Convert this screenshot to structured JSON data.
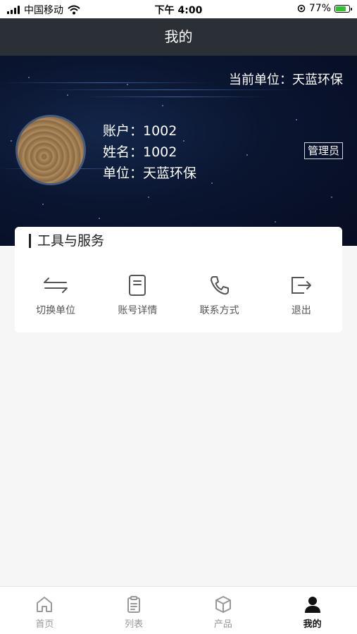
{
  "status_bar": {
    "carrier": "中国移动",
    "time": "下午 4:00",
    "battery": "77%"
  },
  "nav": {
    "title": "我的"
  },
  "header": {
    "current_unit": "当前单位：天蓝环保",
    "account": "账户：1002",
    "name": "姓名：1002",
    "unit": "单位：天蓝环保",
    "role": "管理员"
  },
  "tools": {
    "title": "工具与服务",
    "items": [
      {
        "label": "切换单位",
        "icon": "swap-icon"
      },
      {
        "label": "账号详情",
        "icon": "document-icon"
      },
      {
        "label": "联系方式",
        "icon": "phone-icon"
      },
      {
        "label": "退出",
        "icon": "logout-icon"
      }
    ]
  },
  "tab_bar": {
    "items": [
      {
        "label": "首页",
        "icon": "home-icon"
      },
      {
        "label": "列表",
        "icon": "clipboard-icon"
      },
      {
        "label": "产品",
        "icon": "box-icon"
      },
      {
        "label": "我的",
        "icon": "user-icon"
      }
    ],
    "active_index": 3
  }
}
